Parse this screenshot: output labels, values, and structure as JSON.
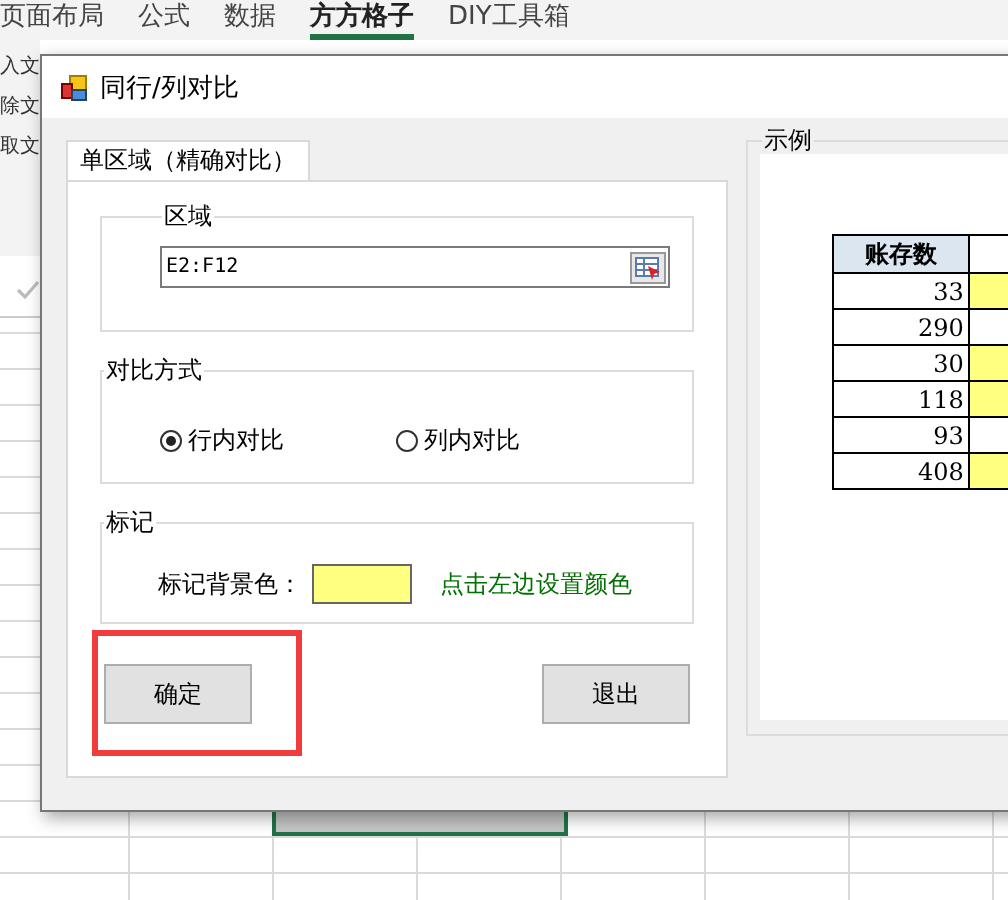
{
  "ribbon_tabs": [
    {
      "label": "页面布局",
      "selected": false
    },
    {
      "label": "公式",
      "selected": false
    },
    {
      "label": "数据",
      "selected": false
    },
    {
      "label": "方方格子",
      "selected": true
    },
    {
      "label": "DIY工具箱",
      "selected": false
    }
  ],
  "ribbon_side_items": [
    "入文",
    "除文",
    "取文"
  ],
  "dialog": {
    "title": "同行/列对比",
    "tabs": [
      {
        "label": "单区域（精确对比）",
        "selected": true
      }
    ],
    "area": {
      "legend": "区域",
      "value": "E2:F12"
    },
    "compare_mode": {
      "legend": "对比方式",
      "options": [
        {
          "label": "行内对比",
          "selected": true
        },
        {
          "label": "列内对比",
          "selected": false
        }
      ]
    },
    "mark": {
      "legend": "标记",
      "label": "标记背景色：",
      "color": "#ffff80",
      "hint": "点击左边设置颜色"
    },
    "buttons": [
      {
        "label": "确定",
        "highlighted": true
      },
      {
        "label": "退出",
        "highlighted": false
      }
    ],
    "example": {
      "legend": "示例",
      "column": "账存数",
      "rows": [
        {
          "value": "33",
          "marked": true
        },
        {
          "value": "290",
          "marked": false
        },
        {
          "value": "30",
          "marked": true
        },
        {
          "value": "118",
          "marked": true
        },
        {
          "value": "93",
          "marked": false
        },
        {
          "value": "408",
          "marked": true
        }
      ]
    }
  }
}
